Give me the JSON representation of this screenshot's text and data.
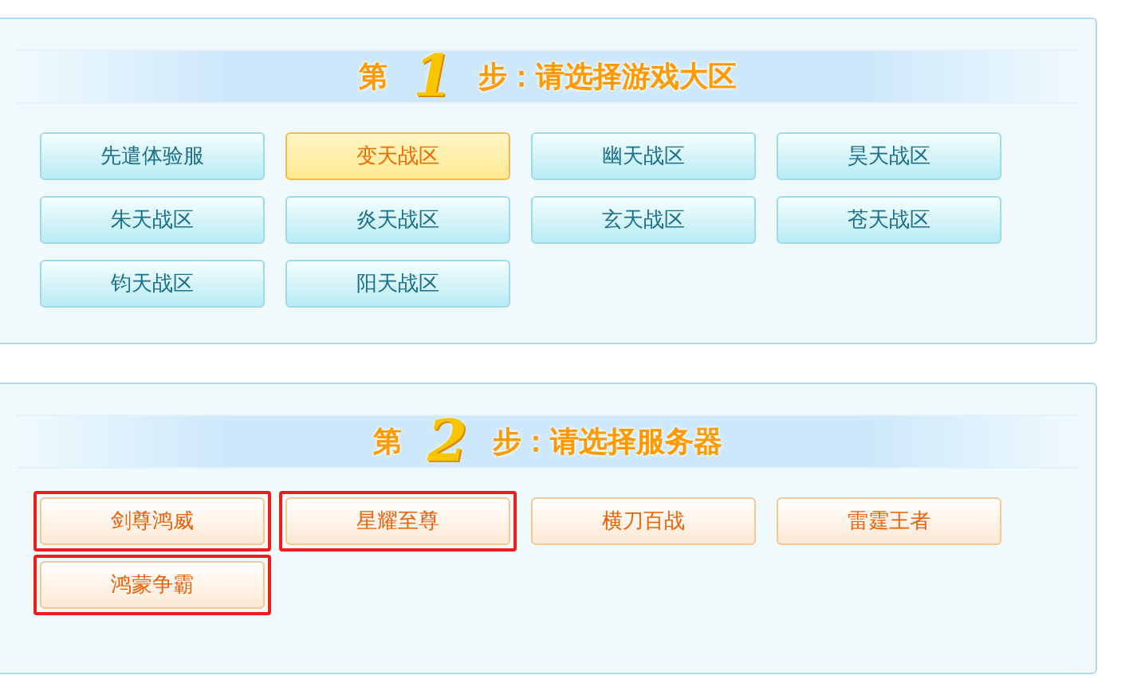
{
  "steps": [
    {
      "prefix": "第",
      "number": "1",
      "title": "步：请选择游戏大区",
      "kind": "zone",
      "items": [
        {
          "label": "先遣体验服",
          "selected": false,
          "marked": false
        },
        {
          "label": "变天战区",
          "selected": true,
          "marked": false
        },
        {
          "label": "幽天战区",
          "selected": false,
          "marked": false
        },
        {
          "label": "昊天战区",
          "selected": false,
          "marked": false
        },
        {
          "label": "朱天战区",
          "selected": false,
          "marked": false
        },
        {
          "label": "炎天战区",
          "selected": false,
          "marked": false
        },
        {
          "label": "玄天战区",
          "selected": false,
          "marked": false
        },
        {
          "label": "苍天战区",
          "selected": false,
          "marked": false
        },
        {
          "label": "钧天战区",
          "selected": false,
          "marked": false
        },
        {
          "label": "阳天战区",
          "selected": false,
          "marked": false
        }
      ]
    },
    {
      "prefix": "第",
      "number": "2",
      "title": "步：请选择服务器",
      "kind": "server",
      "items": [
        {
          "label": "剑尊鸿威",
          "selected": false,
          "marked": true
        },
        {
          "label": "星耀至尊",
          "selected": false,
          "marked": true
        },
        {
          "label": "横刀百战",
          "selected": false,
          "marked": false
        },
        {
          "label": "雷霆王者",
          "selected": false,
          "marked": false
        },
        {
          "label": "鸿蒙争霸",
          "selected": false,
          "marked": true
        }
      ]
    }
  ]
}
